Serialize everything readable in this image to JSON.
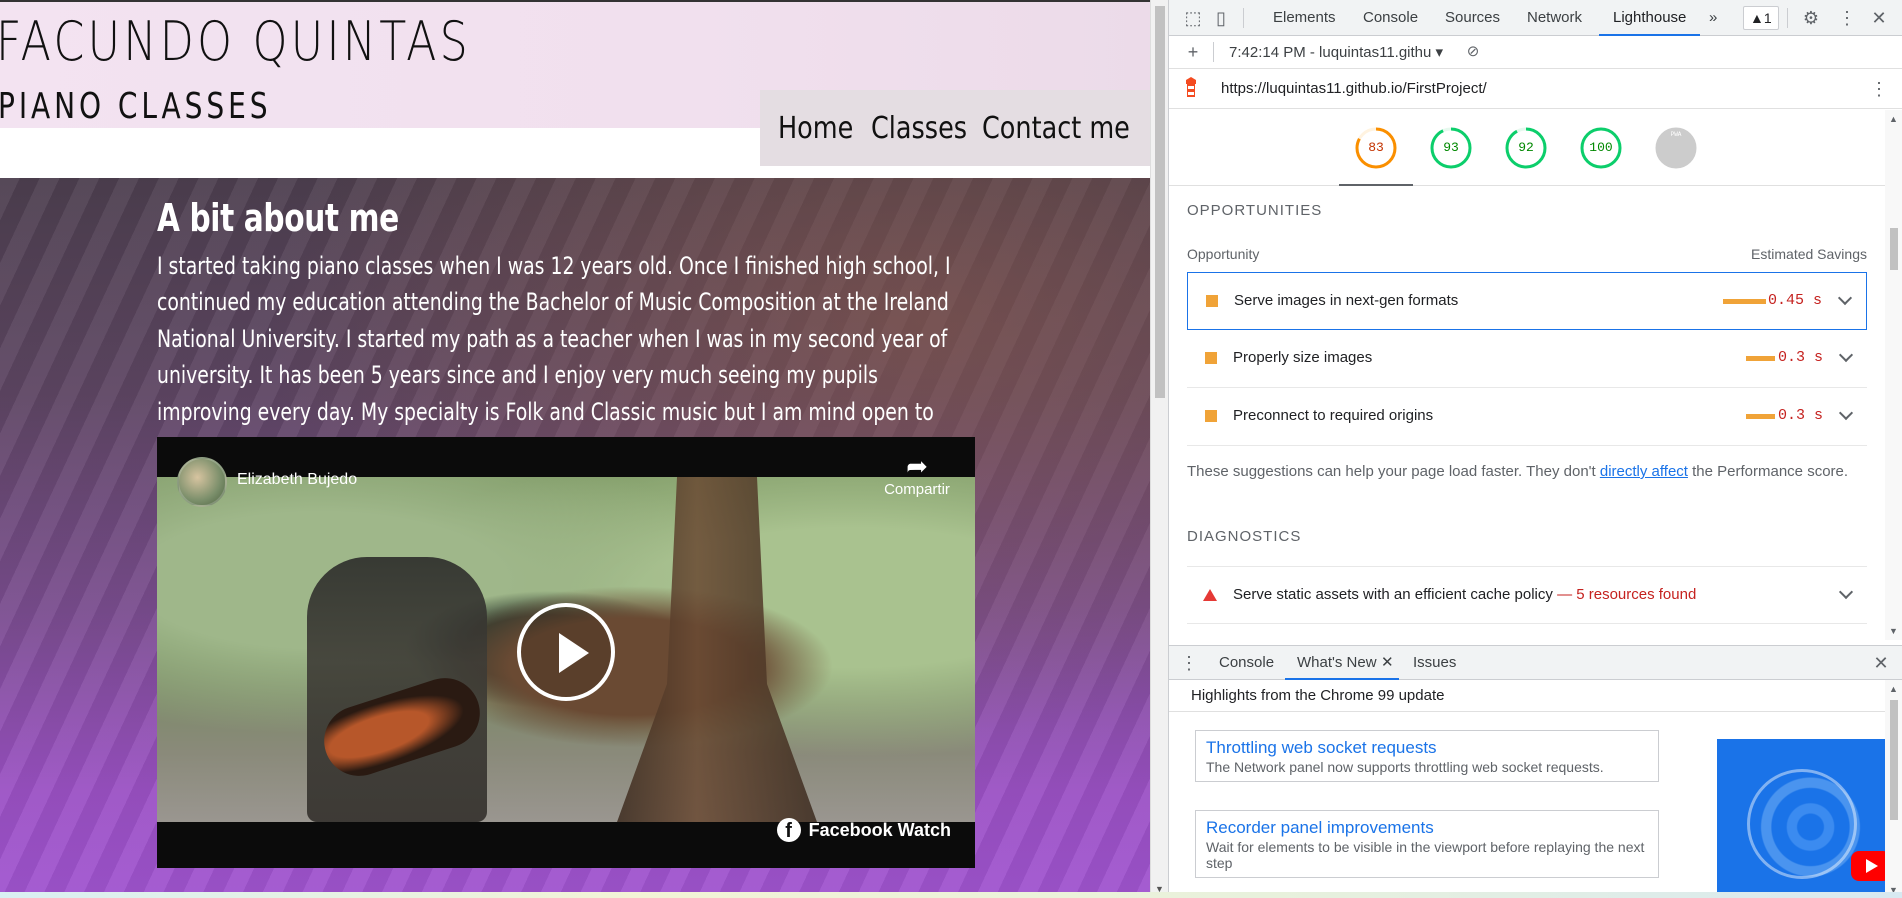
{
  "site": {
    "brand_name": "FACUNDO QUINTAS",
    "brand_subtitle": "PIANO CLASSES",
    "nav": [
      "Home",
      "Classes",
      "Contact me"
    ],
    "about_title": "A bit about me",
    "about_text": "I started taking piano classes when I was 12 years old. Once I finished high school, I continued my education attending the Bachelor of Music Composition at the Ireland National University. I started my path as a teacher when I was in my second year of university. It has been 5 years since and I enjoy very much seeing my pupils improving every day. My specialty is Folk and Classic music but I am mind open to any kind of it. You can see a bit of my work in the next video:",
    "video": {
      "author": "Elizabeth Bujedo",
      "share_label": "Compartir",
      "brand": "Facebook Watch"
    }
  },
  "devtools": {
    "tabs": [
      "Elements",
      "Console",
      "Sources",
      "Network",
      "Lighthouse"
    ],
    "active_tab": "Lighthouse",
    "more_tabs": "»",
    "warning_count": "▲1",
    "report_select": "7:42:14 PM - luquintas11.githu",
    "url": "https://luquintas11.github.io/FirstProject/",
    "scores": [
      {
        "value": "83",
        "color": "#fa8f00",
        "fill": 0.83
      },
      {
        "value": "93",
        "color": "#0cce6b",
        "fill": 0.93
      },
      {
        "value": "92",
        "color": "#0cce6b",
        "fill": 0.92
      },
      {
        "value": "100",
        "color": "#0cce6b",
        "fill": 1.0
      },
      {
        "value": "PWA",
        "color": "#cccccc",
        "fill": 0
      }
    ],
    "opportunities": {
      "title": "OPPORTUNITIES",
      "col_left": "Opportunity",
      "col_right": "Estimated Savings",
      "items": [
        {
          "title": "Serve images in next-gen formats",
          "value": "0.45 s",
          "fill": 0.45
        },
        {
          "title": "Properly size images",
          "value": "0.3 s",
          "fill": 0.3
        },
        {
          "title": "Preconnect to required origins",
          "value": "0.3 s",
          "fill": 0.3
        }
      ],
      "suggest_before": "These suggestions can help your page load faster. They don't ",
      "suggest_link": "directly affect",
      "suggest_after": " the Performance score."
    },
    "diagnostics": {
      "title": "DIAGNOSTICS",
      "item_title": "Serve static assets with an efficient cache policy",
      "item_found": "— 5 resources found"
    },
    "drawer": {
      "tabs": [
        "Console",
        "What's New",
        "Issues"
      ],
      "active_tab": "What's New",
      "highlights": "Highlights from the Chrome 99 update",
      "cards": [
        {
          "title": "Throttling web socket requests",
          "desc": "The Network panel now supports throttling web socket requests."
        },
        {
          "title": "Recorder panel improvements",
          "desc": "Wait for elements to be visible in the viewport before replaying the next step"
        }
      ]
    }
  }
}
